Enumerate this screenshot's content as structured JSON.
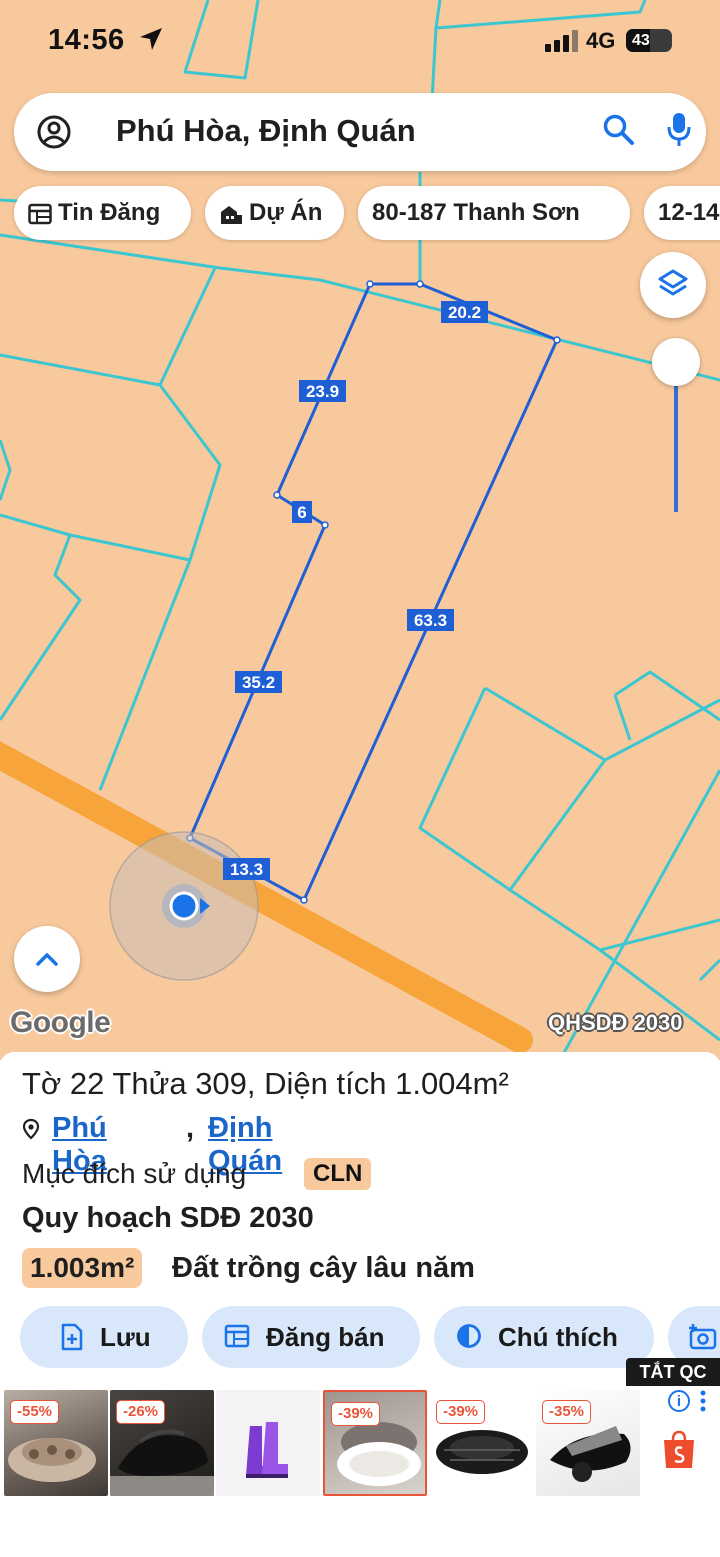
{
  "status_bar": {
    "time": "14:56",
    "network": "4G",
    "battery": "43"
  },
  "search": {
    "query": "Phú Hòa, Định Quán"
  },
  "chips": [
    {
      "label": "Tin Đăng",
      "icon": "listing-icon"
    },
    {
      "label": "Dự Án",
      "icon": "building-icon"
    },
    {
      "label": "80-187 Thanh Sơn",
      "icon": ""
    },
    {
      "label": "12-14",
      "icon": ""
    }
  ],
  "map": {
    "edge_labels": [
      "20.2",
      "23.9",
      "6",
      "35.2",
      "63.3",
      "13.3"
    ],
    "google_logo": "Google",
    "layer_tag": "QHSDĐ 2030",
    "colors": {
      "land": "#f8c99d",
      "parcel_lines": "#3cc6d0",
      "selected_parcel": "#1f5fd6",
      "road": "#f7a43a"
    }
  },
  "parcel": {
    "title": "Tờ 22 Thửa 309, Diện tích 1.004m²",
    "ward": "Phú Hòa",
    "separator": ",",
    "district": "Định Quán",
    "purpose_label": "Mục đích sử dụng",
    "purpose_code": "CLN",
    "plan_title": "Quy hoạch SDĐ 2030",
    "plan_area": "1.003m²",
    "plan_land_type": "Đất trồng cây lâu năm"
  },
  "actions": [
    {
      "label": "Lưu",
      "icon": "add-file-icon"
    },
    {
      "label": "Đăng bán",
      "icon": "listing-icon"
    },
    {
      "label": "Chú thích",
      "icon": "contrast-icon"
    }
  ],
  "ads": {
    "close_label": "TẮT QC",
    "info": "i",
    "discounts": [
      "-55%",
      "-26%",
      "",
      "-39%",
      "-39%",
      "-35%"
    ]
  }
}
